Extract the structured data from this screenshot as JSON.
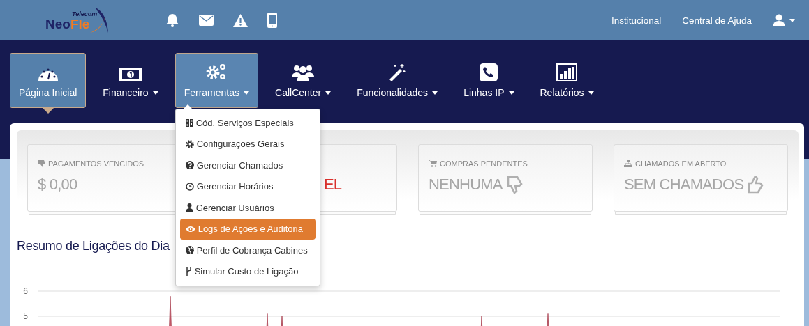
{
  "header": {
    "logo": {
      "tagline": "Telecom",
      "word_1": "Neo",
      "word_2": "Fle"
    },
    "links": [
      "Institucional",
      "Central de Ajuda"
    ]
  },
  "nav": [
    {
      "label": "Página Inicial",
      "selected": true,
      "expanded": false
    },
    {
      "label": "Financeiro",
      "selected": false,
      "expanded": false
    },
    {
      "label": "Ferramentas",
      "selected": false,
      "expanded": true,
      "menu": [
        {
          "label": "Cód. Serviços Especiais",
          "selected": false
        },
        {
          "label": "Configurações Gerais",
          "selected": false
        },
        {
          "label": "Gerenciar Chamados",
          "selected": false
        },
        {
          "label": "Gerenciar Horários",
          "selected": false
        },
        {
          "label": "Gerenciar Usuários",
          "selected": false
        },
        {
          "label": "Logs de Ações e Auditoria",
          "selected": true
        },
        {
          "label": "Perfil de Cobrança Cabines",
          "selected": false
        },
        {
          "label": "Simular Custo de Ligação",
          "selected": false
        }
      ]
    },
    {
      "label": "CallCenter",
      "selected": false,
      "expanded": false
    },
    {
      "label": "Funcionalidades",
      "selected": false,
      "expanded": false
    },
    {
      "label": "Linhas IP",
      "selected": false,
      "expanded": false
    },
    {
      "label": "Relatórios",
      "selected": false,
      "expanded": false
    }
  ],
  "cards": [
    {
      "label": "PAGAMENTOS VENCIDOS",
      "value": "$ 0,00",
      "color": "#a6a6a6"
    },
    {
      "value": "EL",
      "color": "#d9302c"
    },
    {
      "label": "COMPRAS PENDENTES",
      "value": "NENHUMA",
      "color": "#a6a6a6"
    },
    {
      "label": "CHAMADOS EM ABERTO",
      "value": "SEM CHAMADOS",
      "color": "#a6a6a6"
    }
  ],
  "chart_section": {
    "title": "Resumo de Ligações do Dia",
    "y_labels": [
      "6",
      "5"
    ]
  }
}
